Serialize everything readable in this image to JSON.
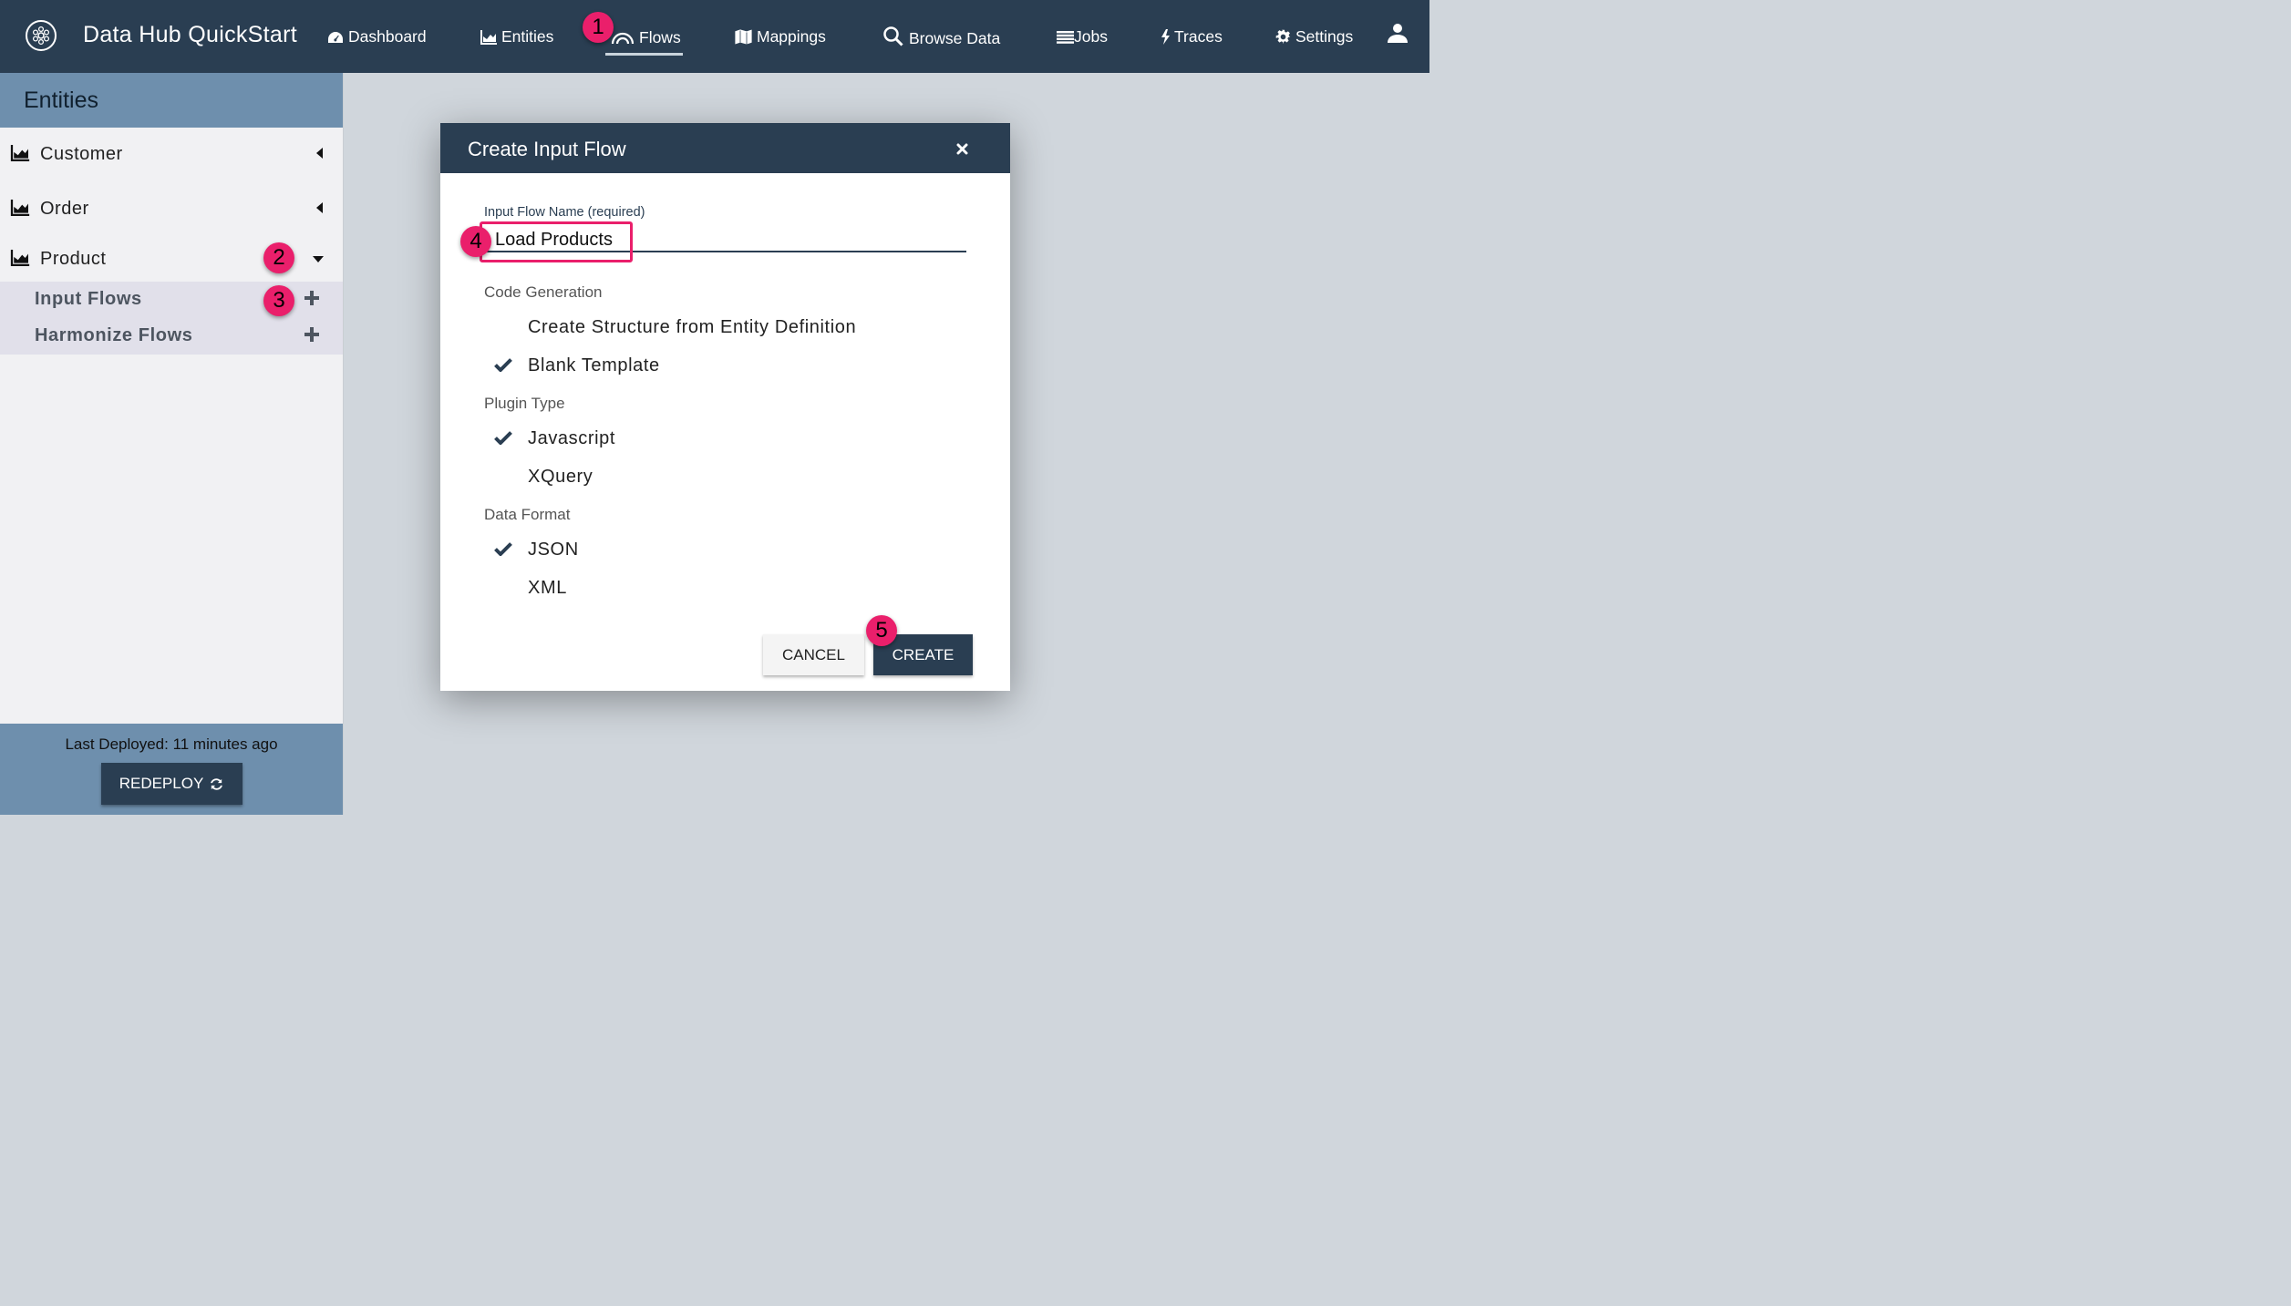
{
  "header": {
    "app_title": "Data Hub QuickStart",
    "nav": [
      {
        "label": "Dashboard",
        "icon": "dashboard-icon"
      },
      {
        "label": "Entities",
        "icon": "chart-icon"
      },
      {
        "label": "Flows",
        "icon": "flows-icon",
        "active": true
      },
      {
        "label": "Mappings",
        "icon": "map-icon"
      },
      {
        "label": "Browse Data",
        "icon": "search-icon"
      },
      {
        "label": "Jobs",
        "icon": "list-icon"
      },
      {
        "label": "Traces",
        "icon": "bolt-icon"
      },
      {
        "label": "Settings",
        "icon": "gear-icon"
      }
    ],
    "user_icon": "user-icon"
  },
  "sidebar": {
    "title": "Entities",
    "entities": [
      {
        "label": "Customer",
        "expanded": false
      },
      {
        "label": "Order",
        "expanded": false
      },
      {
        "label": "Product",
        "expanded": true
      }
    ],
    "sub_items": [
      {
        "label": "Input Flows"
      },
      {
        "label": "Harmonize Flows"
      }
    ],
    "footer": {
      "deploy_text": "Last Deployed: 11 minutes ago",
      "redeploy_label": "REDEPLOY"
    }
  },
  "modal": {
    "title": "Create Input Flow",
    "field_label": "Input Flow Name (required)",
    "field_value": "Load Products",
    "sections": {
      "code_generation": {
        "label": "Code Generation",
        "options": [
          {
            "label": "Create Structure from Entity Definition",
            "checked": false
          },
          {
            "label": "Blank Template",
            "checked": true
          }
        ]
      },
      "plugin_type": {
        "label": "Plugin Type",
        "options": [
          {
            "label": "Javascript",
            "checked": true
          },
          {
            "label": "XQuery",
            "checked": false
          }
        ]
      },
      "data_format": {
        "label": "Data Format",
        "options": [
          {
            "label": "JSON",
            "checked": true
          },
          {
            "label": "XML",
            "checked": false
          }
        ]
      }
    },
    "cancel_label": "CANCEL",
    "create_label": "CREATE"
  },
  "annotations": {
    "markers": [
      "1",
      "2",
      "3",
      "4",
      "5"
    ],
    "accent_color": "#ea1f6b"
  },
  "colors": {
    "nav_bg": "#2a3e52",
    "sidebar_header_bg": "#6e8fad",
    "content_bg": "#d0d6dc"
  }
}
